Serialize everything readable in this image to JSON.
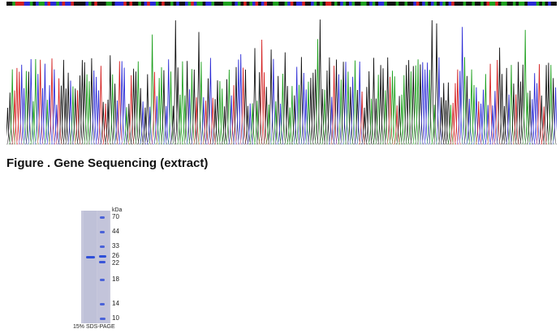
{
  "figure_caption": "Figure . Gene Sequencing (extract)",
  "chromatogram": {
    "base_colors": {
      "A": "#1fa11f",
      "C": "#2b2bd6",
      "G": "#111111",
      "T": "#d42020"
    },
    "sequence": "GGATTTCCAGCAACTCCACTCCTGGGGCAGTGGGAAGCCCTGTGGAGCTCCAGTGGAGCGGCATCAAGCCAGGGAAAGCAGTGACTGCTGGAAGGACTGCCTGGCAGAGTTGAGCAGCAGGAAGCAGCCAGGGAGGAGGCTGCAGCAGCAGCTGGGAGGAGGAGTAATGAAGGAGAAGCCCAGAGCGG",
    "trace_count": 236
  },
  "gel": {
    "unit_label": "kDa",
    "markers": [
      "70",
      "44",
      "33",
      "26",
      "22",
      "18",
      "14",
      "10"
    ],
    "caption": "15% SDS-PAGE",
    "band_color": "#2f4fd8"
  }
}
